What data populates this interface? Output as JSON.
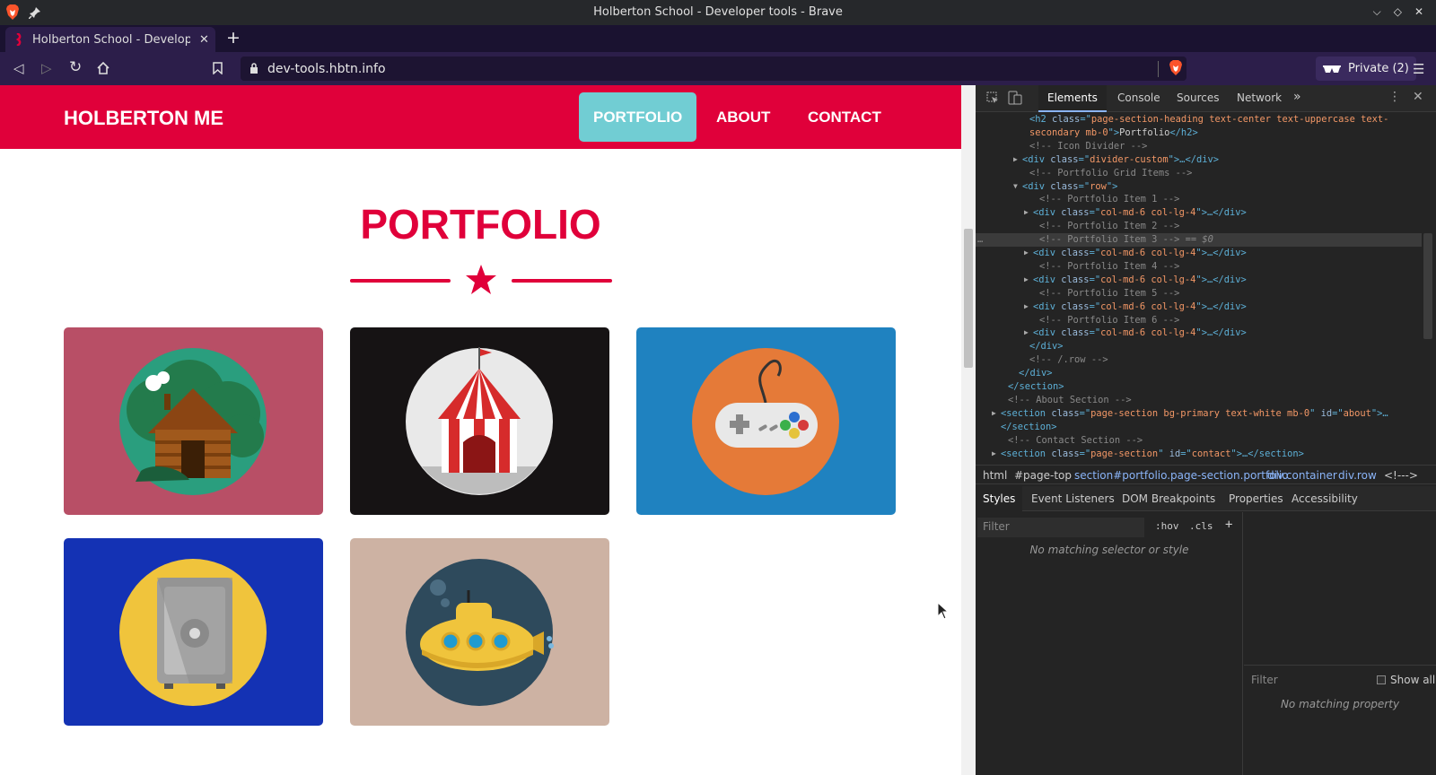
{
  "window": {
    "title": "Holberton School - Developer tools - Brave"
  },
  "tab": {
    "label": "Holberton School - Developer t"
  },
  "address": {
    "url": "dev-tools.hbtn.info"
  },
  "profile": {
    "label": "Private (2)"
  },
  "site": {
    "brand": "HOLBERTON ME",
    "nav": [
      "PORTFOLIO",
      "ABOUT",
      "CONTACT"
    ],
    "active_nav": "PORTFOLIO",
    "heading": "PORTFOLIO",
    "accent": "#e0003a",
    "portfolio": [
      {
        "icon": "cabin-icon",
        "bg": "#b84f66"
      },
      {
        "icon": "circus-tent-icon",
        "bg": "#161314"
      },
      {
        "icon": "game-controller-icon",
        "bg": "#1f82c0"
      },
      {
        "icon": "safe-icon",
        "bg": "#1432b4"
      },
      {
        "icon": "submarine-icon",
        "bg": "#cdb2a3"
      }
    ]
  },
  "devtools": {
    "tabs": [
      "Elements",
      "Console",
      "Sources",
      "Network"
    ],
    "active_tab": "Elements",
    "more_tabs": "»",
    "code_lines": [
      [
        "<h2 ",
        "class",
        "=\"",
        "page-section-heading text-center text-uppercase text-",
        "",
        "",
        ""
      ],
      [
        "secondary mb-0",
        "\">",
        "Portfolio",
        "</h2>"
      ],
      [
        "<!-- Icon Divider -->"
      ],
      [
        "<div ",
        "class",
        "=\"",
        "divider-custom",
        "\">…</div>"
      ],
      [
        "<!-- Portfolio Grid Items -->"
      ],
      [
        "<div ",
        "class",
        "=\"",
        "row",
        "\">"
      ],
      [
        "<!-- Portfolio Item 1 -->"
      ],
      [
        "<div ",
        "class",
        "=\"",
        "col-md-6 col-lg-4",
        "\">…</div>"
      ],
      [
        "<!-- Portfolio Item 2 -->"
      ],
      [
        "<!-- Portfolio Item 3 -->",
        " == $0"
      ],
      [
        "<div ",
        "class",
        "=\"",
        "col-md-6 col-lg-4",
        "\">…</div>"
      ],
      [
        "<!-- Portfolio Item 4 -->"
      ],
      [
        "<div ",
        "class",
        "=\"",
        "col-md-6 col-lg-4",
        "\">…</div>"
      ],
      [
        "<!-- Portfolio Item 5 -->"
      ],
      [
        "<div ",
        "class",
        "=\"",
        "col-md-6 col-lg-4",
        "\">…</div>"
      ],
      [
        "<!-- Portfolio Item 6 -->"
      ],
      [
        "<div ",
        "class",
        "=\"",
        "col-md-6 col-lg-4",
        "\">…</div>"
      ],
      [
        "</div>"
      ],
      [
        "<!-- /.row -->"
      ],
      [
        "</div>"
      ],
      [
        "</section>"
      ],
      [
        "<!-- About Section -->"
      ],
      [
        "<section ",
        "class",
        "=\"",
        "page-section bg-primary text-white mb-0",
        "\" ",
        "id",
        "=\"",
        "about",
        "\">…"
      ],
      [
        "</section>"
      ],
      [
        "<!-- Contact Section -->"
      ],
      [
        "<section ",
        "class",
        "=\"",
        "page-section",
        "\" ",
        "id",
        "=\"",
        "contact",
        "\">…</section>"
      ]
    ],
    "breadcrumbs": [
      "html",
      "#page-top",
      "section#portfolio.page-section.portfolio",
      "div.container",
      "div.row",
      "<!--->"
    ],
    "pane_tabs": [
      "Styles",
      "Event Listeners",
      "DOM Breakpoints",
      "Properties",
      "Accessibility"
    ],
    "active_pane": "Styles",
    "styles_filter_placeholder": "Filter",
    "hov": ":hov",
    "cls": ".cls",
    "plus": "+",
    "styles_empty": "No matching selector or style",
    "computed_filter_placeholder": "Filter",
    "show_all": "Show all",
    "computed_empty": "No matching property"
  }
}
